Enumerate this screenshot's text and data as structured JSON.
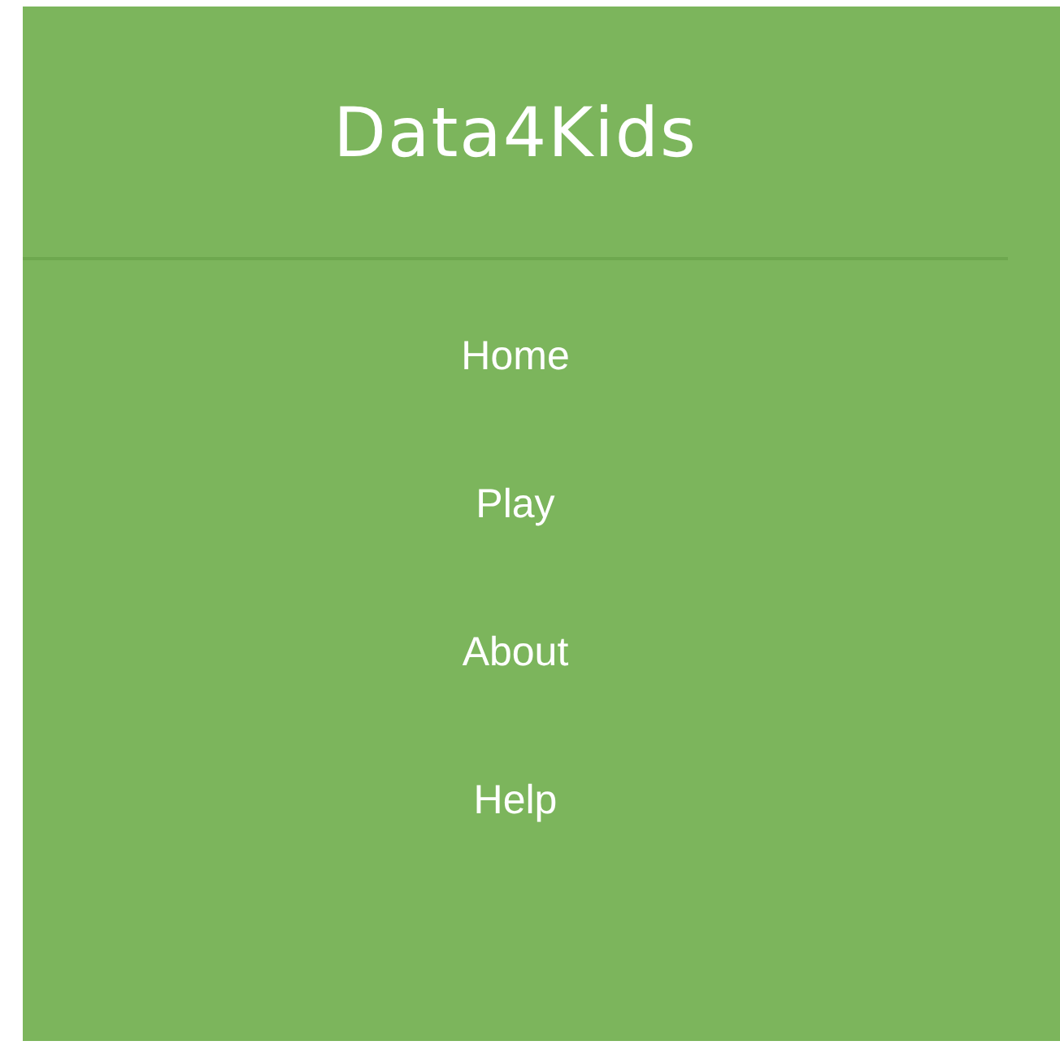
{
  "header": {
    "title": "Data4Kids"
  },
  "nav": {
    "items": [
      {
        "label": "Home"
      },
      {
        "label": "Play"
      },
      {
        "label": "About"
      },
      {
        "label": "Help"
      }
    ]
  }
}
